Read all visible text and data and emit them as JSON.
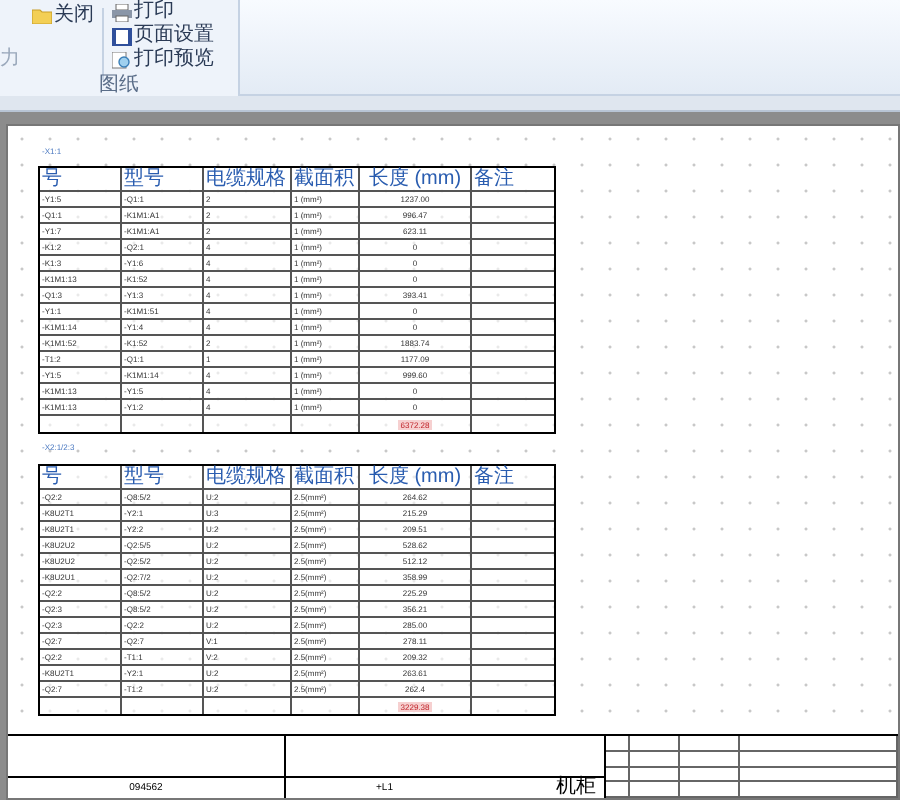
{
  "ribbon": {
    "buttons": [
      {
        "label": "关闭",
        "kind": "folder"
      },
      {
        "label": "打印",
        "kind": "print"
      },
      {
        "label": "页面设置",
        "kind": "setup"
      },
      {
        "label": "打印预览",
        "kind": "preview"
      }
    ],
    "left_label": "力",
    "group": "图纸"
  },
  "tables": [
    {
      "caption": "-X1:1",
      "columns": [
        "号",
        "型号",
        "电缆规格",
        "截面积",
        "长度 (mm)",
        "备注"
      ],
      "rows": [
        [
          "-Y1:5",
          "-Q1:1",
          "2",
          "1 (mm²)",
          "1237.00"
        ],
        [
          "-Q1:1",
          "-K1M1:A1",
          "2",
          "1 (mm²)",
          "996.47"
        ],
        [
          "-Y1:7",
          "-K1M1:A1",
          "2",
          "1 (mm²)",
          "623.11"
        ],
        [
          "-K1:2",
          "-Q2:1",
          "4",
          "1 (mm²)",
          "0"
        ],
        [
          "-K1:3",
          "-Y1:6",
          "4",
          "1 (mm²)",
          "0"
        ],
        [
          "-K1M1:13",
          "-K1:52",
          "4",
          "1 (mm²)",
          "0"
        ],
        [
          "-Q1:3",
          "-Y1:3",
          "4",
          "1 (mm²)",
          "393.41"
        ],
        [
          "-Y1:1",
          "-K1M1:51",
          "4",
          "1 (mm²)",
          "0"
        ],
        [
          "-K1M1:14",
          "-Y1:4",
          "4",
          "1 (mm²)",
          "0"
        ],
        [
          "-K1M1:52",
          "-K1:52",
          "2",
          "1 (mm²)",
          "1883.74"
        ],
        [
          "-T1:2",
          "-Q1:1",
          "1",
          "1 (mm²)",
          "1177.09"
        ],
        [
          "-Y1:5",
          "-K1M1:14",
          "4",
          "1 (mm²)",
          "999.60"
        ],
        [
          "-K1M1:13",
          "-Y1:5",
          "4",
          "1 (mm²)",
          "0"
        ],
        [
          "-K1M1:13",
          "-Y1:2",
          "4",
          "1 (mm²)",
          "0"
        ]
      ],
      "total": "6372.28"
    },
    {
      "caption": "-X2:1/2:3",
      "columns": [
        "号",
        "型号",
        "电缆规格",
        "截面积",
        "长度 (mm)",
        "备注"
      ],
      "rows": [
        [
          "-Q2:2",
          "-Q8:5/2",
          "U:2",
          "2.5(mm²)",
          "264.62"
        ],
        [
          "-K8U2T1",
          "-Y2:1",
          "U:3",
          "2.5(mm²)",
          "215.29"
        ],
        [
          "-K8U2T1",
          "-Y2:2",
          "U:2",
          "2.5(mm²)",
          "209.51"
        ],
        [
          "-K8U2U2",
          "-Q2:5/5",
          "U:2",
          "2.5(mm²)",
          "528.62"
        ],
        [
          "-K8U2U2",
          "-Q2:5/2",
          "U:2",
          "2.5(mm²)",
          "512.12"
        ],
        [
          "-K8U2U1",
          "-Q2:7/2",
          "U:2",
          "2.5(mm²)",
          "358.99"
        ],
        [
          "-Q2:2",
          "-Q8:5/2",
          "U:2",
          "2.5(mm²)",
          "225.29"
        ],
        [
          "-Q2:3",
          "-Q8:5/2",
          "U:2",
          "2.5(mm²)",
          "356.21"
        ],
        [
          "-Q2:3",
          "-Q2:2",
          "U:2",
          "2.5(mm²)",
          "285.00"
        ],
        [
          "-Q2:7",
          "-Q2:7",
          "V:1",
          "2.5(mm²)",
          "278.11"
        ],
        [
          "-Q2:2",
          "-T1:1",
          "V:2",
          "2.5(mm²)",
          "209.32"
        ],
        [
          "-K8U2T1",
          "-Y2:1",
          "U:2",
          "2.5(mm²)",
          "263.61"
        ],
        [
          "-Q2:7",
          "-T1:2",
          "U:2",
          "2.5(mm²)",
          "262.4"
        ]
      ],
      "total": "3229.38"
    }
  ],
  "title_block": {
    "drawing_no": "094562",
    "location": "+L1",
    "cabinet": "机柜"
  }
}
